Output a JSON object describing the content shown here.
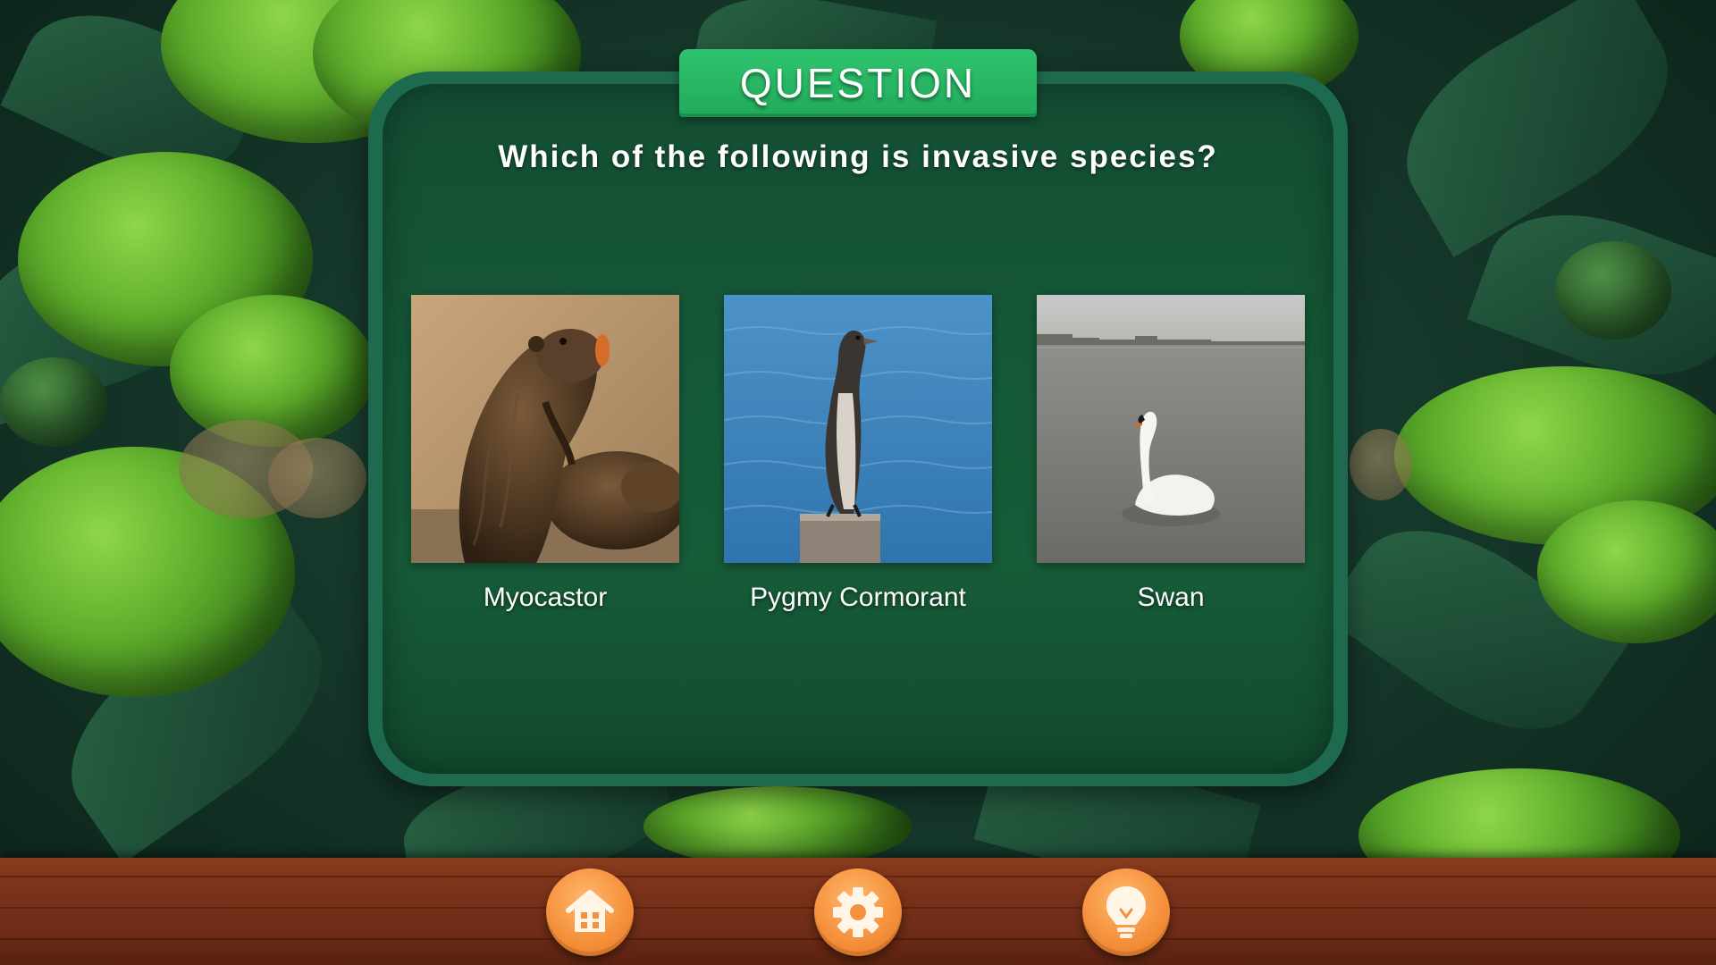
{
  "header": {
    "title": "QUESTION"
  },
  "question": {
    "text": "Which of the following is invasive species?"
  },
  "options": [
    {
      "label": "Myocastor",
      "image_icon": "nutria-photo"
    },
    {
      "label": "Pygmy Cormorant",
      "image_icon": "cormorant-photo"
    },
    {
      "label": "Swan",
      "image_icon": "swan-photo"
    }
  ],
  "toolbar": {
    "buttons": [
      {
        "icon": "home-icon"
      },
      {
        "icon": "gear-icon"
      },
      {
        "icon": "lightbulb-icon"
      }
    ]
  },
  "colors": {
    "panel": "#155a38",
    "title_tab": "#22aa5b",
    "button": "#f5913c",
    "bar": "#7a321a"
  }
}
